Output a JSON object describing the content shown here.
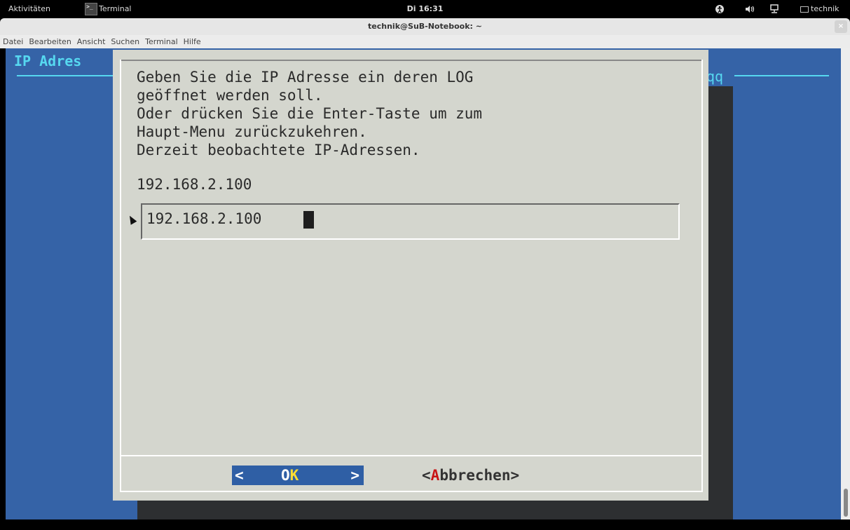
{
  "topbar": {
    "activities": "Aktivitäten",
    "app_name": "Terminal",
    "app_icon_glyph": ">_",
    "clock": "Di 16:31",
    "user": "technik",
    "icons": [
      "accessibility-icon",
      "volume-icon",
      "network-icon",
      "user-icon"
    ]
  },
  "window": {
    "title": "technik@SuB-Notebook: ~",
    "close_glyph": "×"
  },
  "menubar": {
    "items": [
      "Datei",
      "Bearbeiten",
      "Ansicht",
      "Suchen",
      "Terminal",
      "Hilfe"
    ]
  },
  "terminal": {
    "background_title": "IP Adres",
    "background_title_right": "qq",
    "colors": {
      "background": "#3563a7",
      "dialog": "#d4d6ce",
      "accent": "#56d8f0",
      "hotkey_ok": "#ffdd33",
      "hotkey_cancel": "#c81414"
    }
  },
  "dialog": {
    "prompt": "Geben Sie die IP Adresse ein deren LOG\ngeöffnet werden soll.\nOder drücken Sie die Enter-Taste um zum\nHaupt-Menu zurückzukehren.\nDerzeit beobachtete IP-Adressen.",
    "watched_ip": "192.168.2.100",
    "input_value": "192.168.2.100",
    "ok": {
      "left": "<",
      "before": "O",
      "hotkey": "K",
      "right": ">"
    },
    "cancel": {
      "open": "<",
      "hotkey": "A",
      "rest": "bbrechen",
      "close": ">"
    }
  }
}
